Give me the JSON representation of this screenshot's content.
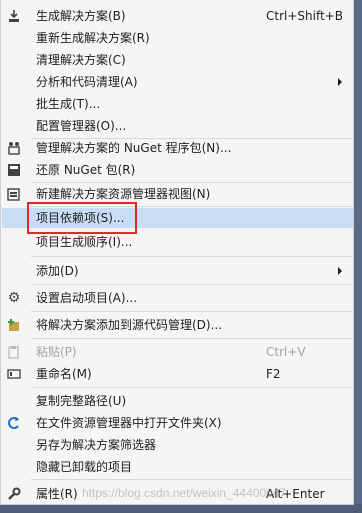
{
  "menu": {
    "items": [
      {
        "label": "生成解决方案(B)",
        "shortcut": "Ctrl+Shift+B",
        "icon": "build-icon"
      },
      {
        "label": "重新生成解决方案(R)"
      },
      {
        "label": "清理解决方案(C)"
      },
      {
        "label": "分析和代码清理(A)",
        "submenu": true
      },
      {
        "label": "批生成(T)..."
      },
      {
        "label": "配置管理器(O)..."
      },
      {
        "label": "管理解决方案的 NuGet 程序包(N)...",
        "icon": "nuget-package-icon"
      },
      {
        "label": "还原 NuGet 包(R)",
        "icon": "nuget-restore-icon"
      },
      {
        "label": "新建解决方案资源管理器视图(N)",
        "icon": "new-view-icon"
      },
      {
        "label": "项目依赖项(S)...",
        "highlighted": true
      },
      {
        "label": "项目生成顺序(I)..."
      },
      {
        "label": "添加(D)",
        "submenu": true
      },
      {
        "label": "设置启动项目(A)...",
        "icon": "gear-icon"
      },
      {
        "label": "将解决方案添加到源代码管理(D)...",
        "icon": "source-control-add-icon"
      },
      {
        "label": "粘贴(P)",
        "shortcut": "Ctrl+V",
        "icon": "paste-icon",
        "disabled": true
      },
      {
        "label": "重命名(M)",
        "shortcut": "F2",
        "icon": "rename-icon"
      },
      {
        "label": "复制完整路径(U)"
      },
      {
        "label": "在文件资源管理器中打开文件夹(X)",
        "icon": "open-folder-icon"
      },
      {
        "label": "另存为解决方案筛选器"
      },
      {
        "label": "隐藏已卸载的项目"
      },
      {
        "label": "属性(R)",
        "shortcut": "Alt+Enter",
        "icon": "wrench-icon"
      }
    ]
  },
  "watermark": "https://blog.csdn.net/weixin_44400047",
  "colors": {
    "menu_bg": "#f5f5f5",
    "highlight": "#c9dcf5",
    "annotation_border": "#e02a2a",
    "disabled_text": "#a2a4a5"
  }
}
